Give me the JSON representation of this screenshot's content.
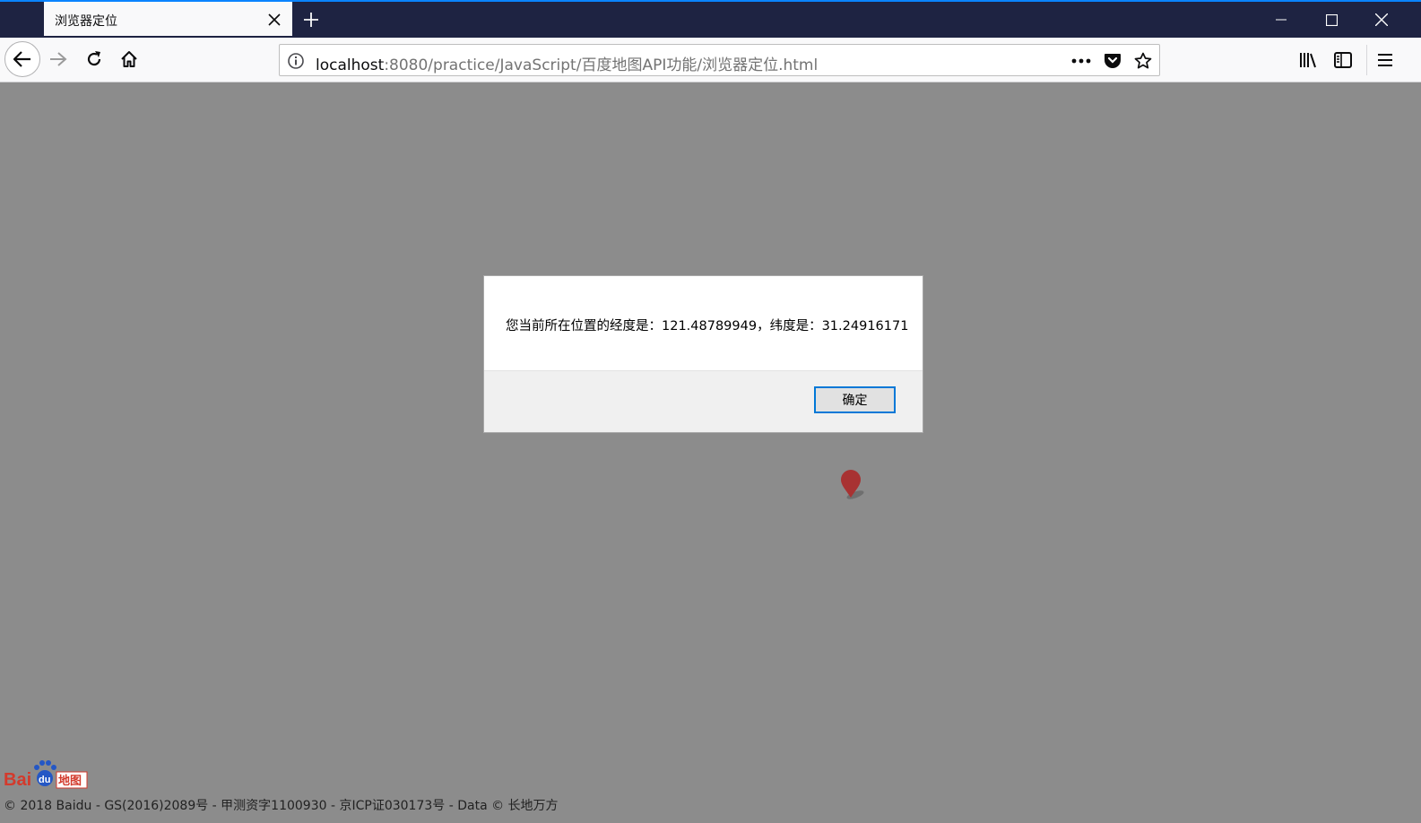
{
  "tab": {
    "title": "浏览器定位"
  },
  "url": {
    "host": "localhost",
    "rest": ":8080/practice/JavaScript/百度地图API功能/浏览器定位.html"
  },
  "dialog": {
    "message": "您当前所在位置的经度是：121.48789949，纬度是：31.24916171",
    "ok_label": "确定"
  },
  "map": {
    "copyright": "© 2018 Baidu - GS(2016)2089号 - 甲测资字1100930 - 京ICP证030173号 - Data © 长地万方",
    "logo_text": "Bai du 地图"
  },
  "colors": {
    "titlebar": "#1e2342",
    "accent": "#0a84ff",
    "map_overlay": "#8c8c8c",
    "marker": "#a83232"
  }
}
